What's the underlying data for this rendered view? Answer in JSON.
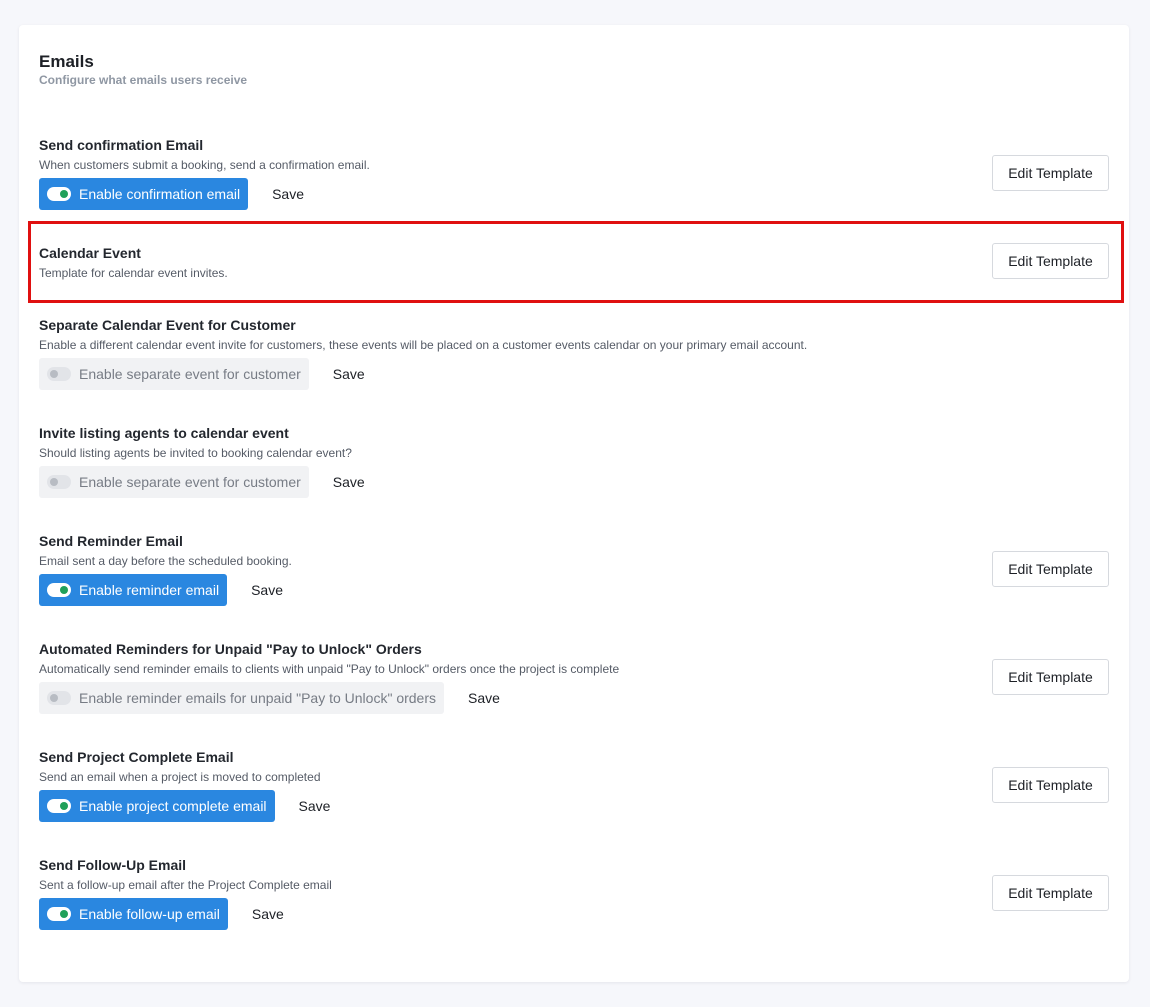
{
  "section": {
    "title": "Emails",
    "subtitle": "Configure what emails users receive"
  },
  "rows": [
    {
      "title": "Send confirmation Email",
      "description": "When customers submit a booking, send a confirmation email.",
      "toggle_label": "Enable confirmation email",
      "toggle_on": true,
      "save_label": "Save",
      "edit_label": "Edit Template"
    },
    {
      "title": "Calendar Event",
      "description": "Template for calendar event invites.",
      "edit_label": "Edit Template",
      "highlighted": true
    },
    {
      "title": "Separate Calendar Event for Customer",
      "description": "Enable a different calendar event invite for customers, these events will be placed on a customer events calendar on your primary email account.",
      "toggle_label": "Enable separate event for customer",
      "toggle_on": false,
      "save_label": "Save"
    },
    {
      "title": "Invite listing agents to calendar event",
      "description": "Should listing agents be invited to booking calendar event?",
      "toggle_label": "Enable separate event for customer",
      "toggle_on": false,
      "save_label": "Save"
    },
    {
      "title": "Send Reminder Email",
      "description": "Email sent a day before the scheduled booking.",
      "toggle_label": "Enable reminder email",
      "toggle_on": true,
      "save_label": "Save",
      "edit_label": "Edit Template"
    },
    {
      "title": "Automated Reminders for Unpaid \"Pay to Unlock\" Orders",
      "description": "Automatically send reminder emails to clients with unpaid \"Pay to Unlock\" orders once the project is complete",
      "toggle_label": "Enable reminder emails for unpaid \"Pay to Unlock\" orders",
      "toggle_on": false,
      "save_label": "Save",
      "edit_label": "Edit Template"
    },
    {
      "title": "Send Project Complete Email",
      "description": "Send an email when a project is moved to completed",
      "toggle_label": "Enable project complete email",
      "toggle_on": true,
      "save_label": "Save",
      "edit_label": "Edit Template"
    },
    {
      "title": "Send Follow-Up Email",
      "description": "Sent a follow-up email after the Project Complete email",
      "toggle_label": "Enable follow-up email",
      "toggle_on": true,
      "save_label": "Save",
      "edit_label": "Edit Template"
    }
  ],
  "colors": {
    "accent": "#2a87e0",
    "toggle_knob_on": "#20a05a",
    "highlight": "#e01010"
  }
}
